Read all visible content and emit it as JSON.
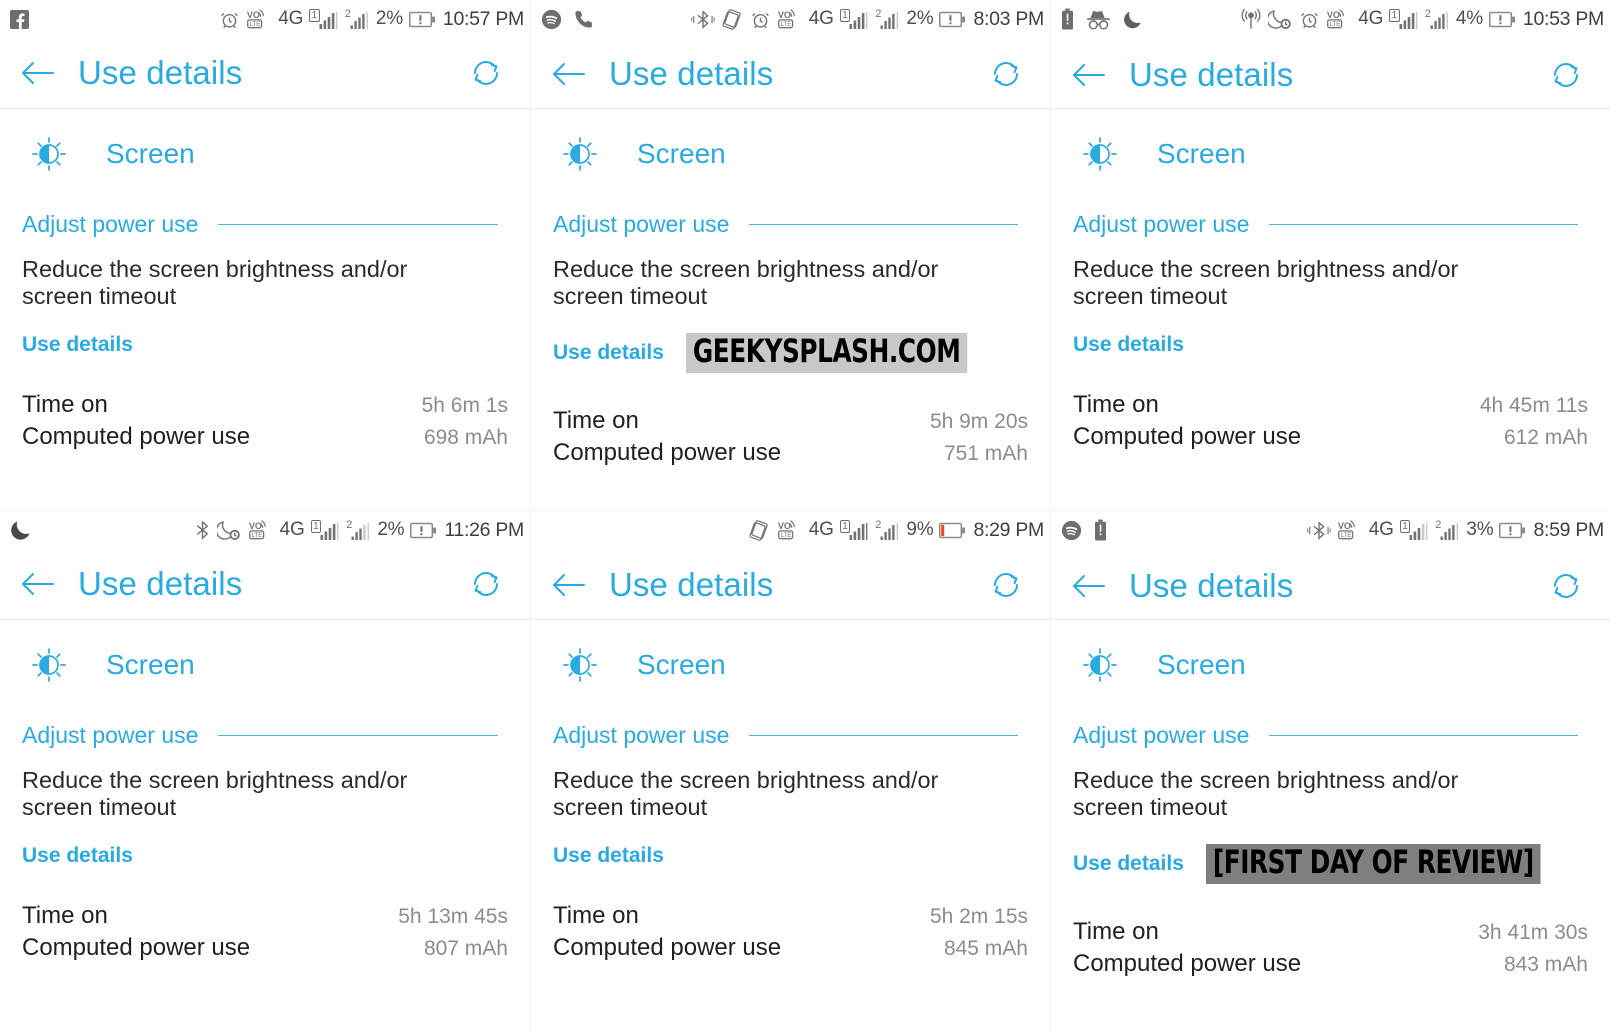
{
  "app": {
    "title": "Use details",
    "back_icon": "arrow-left-icon",
    "refresh_icon": "refresh-icon",
    "item_icon": "brightness-icon",
    "item_label": "Screen",
    "section_title": "Adjust power use",
    "description": "Reduce the screen brightness and/or screen timeout",
    "use_details_link": "Use details",
    "stat_labels": {
      "time_on": "Time on",
      "computed_power_use": "Computed power use"
    },
    "accent_color": "#29ABE2",
    "value_color": "#8c8c8c"
  },
  "panels": [
    {
      "id": "panel-1",
      "status": {
        "left_icons": [
          "facebook-icon"
        ],
        "right_icons": [
          "alarm-icon",
          "volte-icon",
          "network-4g-icon",
          "signal-sim1-icon",
          "signal-sim2-icon"
        ],
        "battery_percent": "2%",
        "battery_icon": "battery-alert-icon",
        "clock": "10:57 PM"
      },
      "time_on": "5h 6m 1s",
      "computed_power_use": "698 mAh",
      "watermark": null
    },
    {
      "id": "panel-2",
      "status": {
        "left_icons": [
          "spotify-icon",
          "phone-call-icon"
        ],
        "right_icons": [
          "bluetooth-active-icon",
          "screen-rotate-icon",
          "alarm-icon",
          "volte-icon",
          "network-4g-icon",
          "signal-sim1-icon",
          "signal-sim2-icon"
        ],
        "battery_percent": "2%",
        "battery_icon": "battery-alert-icon",
        "clock": "8:03 PM"
      },
      "time_on": "5h 9m 20s",
      "computed_power_use": "751 mAh",
      "watermark": {
        "text": "GEEKYSPLASH.COM",
        "style": "light"
      }
    },
    {
      "id": "panel-3",
      "status": {
        "left_icons": [
          "battery-saver-icon",
          "incognito-icon",
          "moon-icon"
        ],
        "right_icons": [
          "location-icon",
          "do-not-disturb-schedule-icon",
          "alarm-icon",
          "volte-icon",
          "network-4g-icon",
          "signal-sim1-icon",
          "signal-sim2-icon"
        ],
        "battery_percent": "4%",
        "battery_icon": "battery-alert-icon",
        "clock": "10:53 PM"
      },
      "time_on": "4h 45m 11s",
      "computed_power_use": "612 mAh",
      "watermark": null
    },
    {
      "id": "panel-4",
      "status": {
        "left_icons": [
          "moon-icon"
        ],
        "right_icons": [
          "bluetooth-off-icon",
          "do-not-disturb-schedule-icon",
          "volte-icon",
          "network-4g-icon",
          "signal-sim1-icon",
          "signal-sim2-icon"
        ],
        "battery_percent": "2%",
        "battery_icon": "battery-alert-icon",
        "clock": "11:26 PM"
      },
      "time_on": "5h 13m 45s",
      "computed_power_use": "807 mAh",
      "watermark": null
    },
    {
      "id": "panel-5",
      "status": {
        "left_icons": [],
        "right_icons": [
          "screen-rotate-icon",
          "volte-icon",
          "network-4g-icon",
          "signal-sim1-icon",
          "signal-sim2-icon"
        ],
        "battery_percent": "9%",
        "battery_icon": "battery-low-icon",
        "clock": "8:29 PM"
      },
      "time_on": "5h 2m 15s",
      "computed_power_use": "845 mAh",
      "watermark": null
    },
    {
      "id": "panel-6",
      "status": {
        "left_icons": [
          "spotify-icon",
          "battery-saver-icon"
        ],
        "right_icons": [
          "bluetooth-active-icon",
          "volte-icon",
          "network-4g-icon",
          "signal-sim1-icon",
          "signal-sim2-icon"
        ],
        "battery_percent": "3%",
        "battery_icon": "battery-alert-icon",
        "clock": "8:59 PM"
      },
      "time_on": "3h 41m 30s",
      "computed_power_use": "843 mAh",
      "watermark": {
        "text": "[FIRST DAY OF REVIEW]",
        "style": "dark"
      }
    }
  ]
}
